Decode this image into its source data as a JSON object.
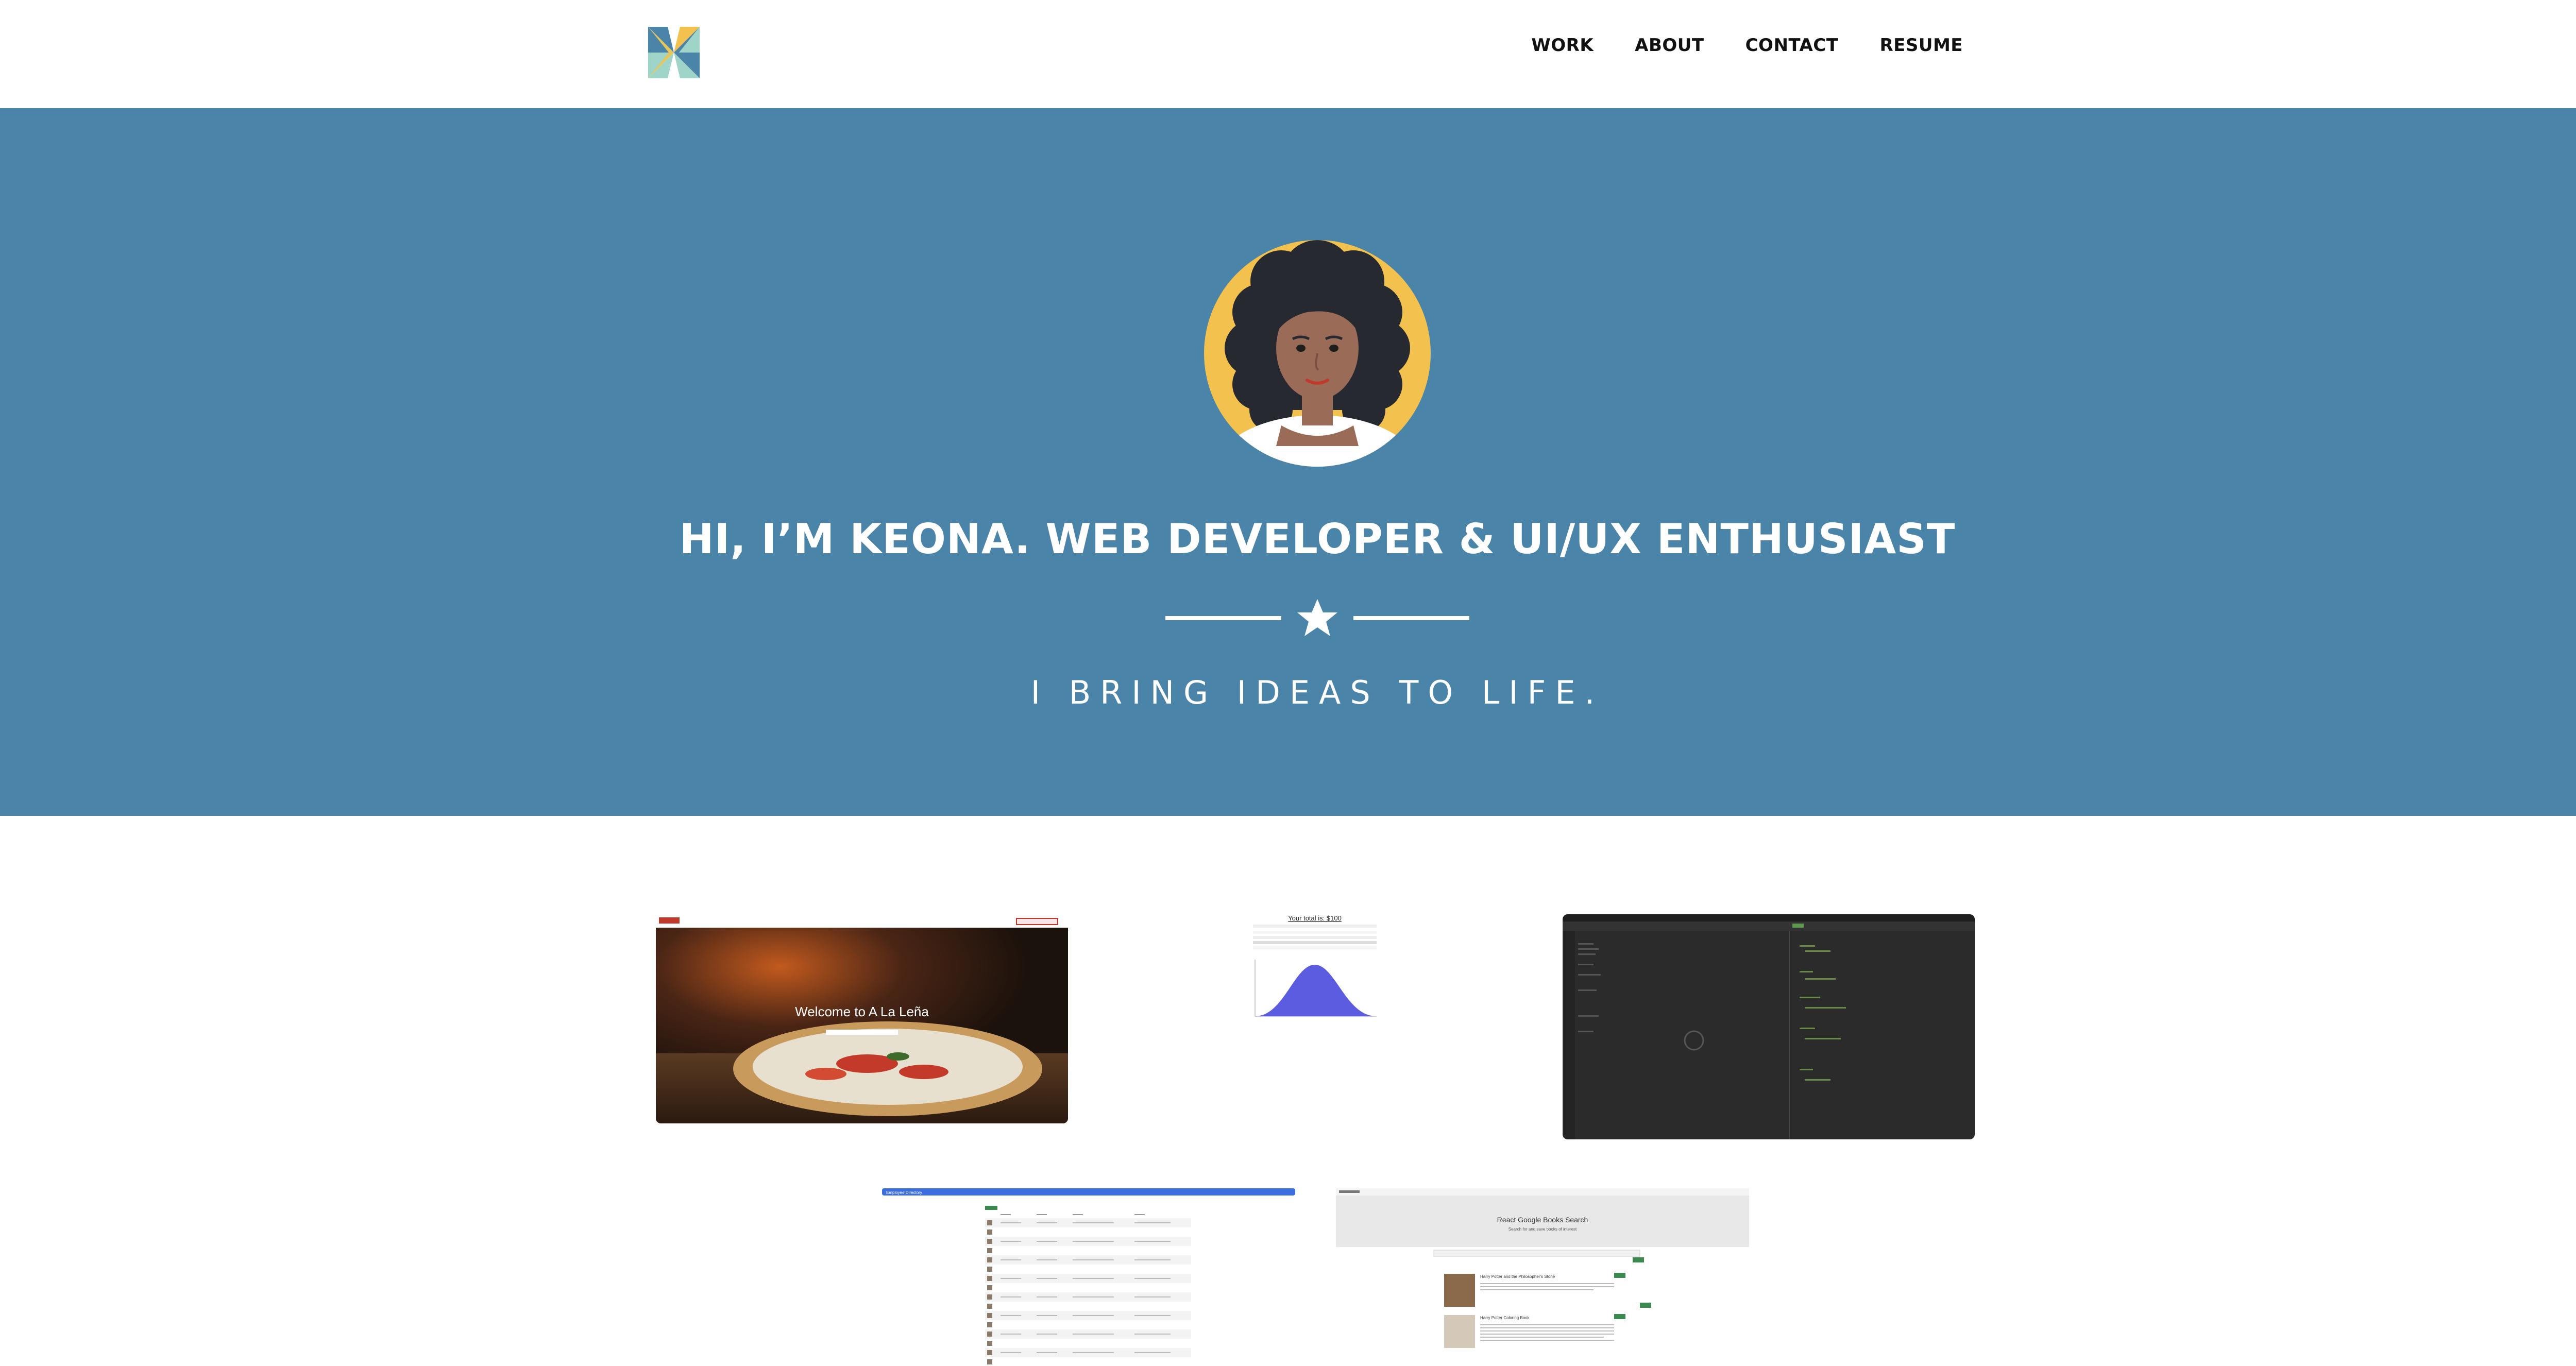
{
  "nav": {
    "logo_name": "logo",
    "links": [
      {
        "label": "WORK"
      },
      {
        "label": "ABOUT"
      },
      {
        "label": "CONTACT"
      },
      {
        "label": "RESUME"
      }
    ]
  },
  "hero": {
    "title": "HI, I’M KEONA. WEB DEVELOPER & UI/UX ENTHUSIAST",
    "tagline": "I BRING IDEAS TO LIFE.",
    "divider_icon": "star-icon",
    "background": "#4a84a8"
  },
  "projects": [
    {
      "name": "a-la-lena",
      "headline": "Welcome to A La Leña"
    },
    {
      "name": "budget-chart",
      "headline": "Your total is: $100"
    },
    {
      "name": "code-editor"
    },
    {
      "name": "employee-directory",
      "headline": "Employee Directory"
    },
    {
      "name": "google-books-search",
      "headline": "React Google Books Search",
      "subhead": "Search for and save books of interest",
      "book_titles": [
        "Harry Potter and the Philosopher's Stone",
        "Harry Potter Coloring Book"
      ]
    }
  ],
  "colors": {
    "hero_blue": "#4a84a8",
    "avatar_ring": "#f2c14e",
    "chart_fill": "#5b5ce0",
    "editor_dark": "#2b2b2b"
  }
}
